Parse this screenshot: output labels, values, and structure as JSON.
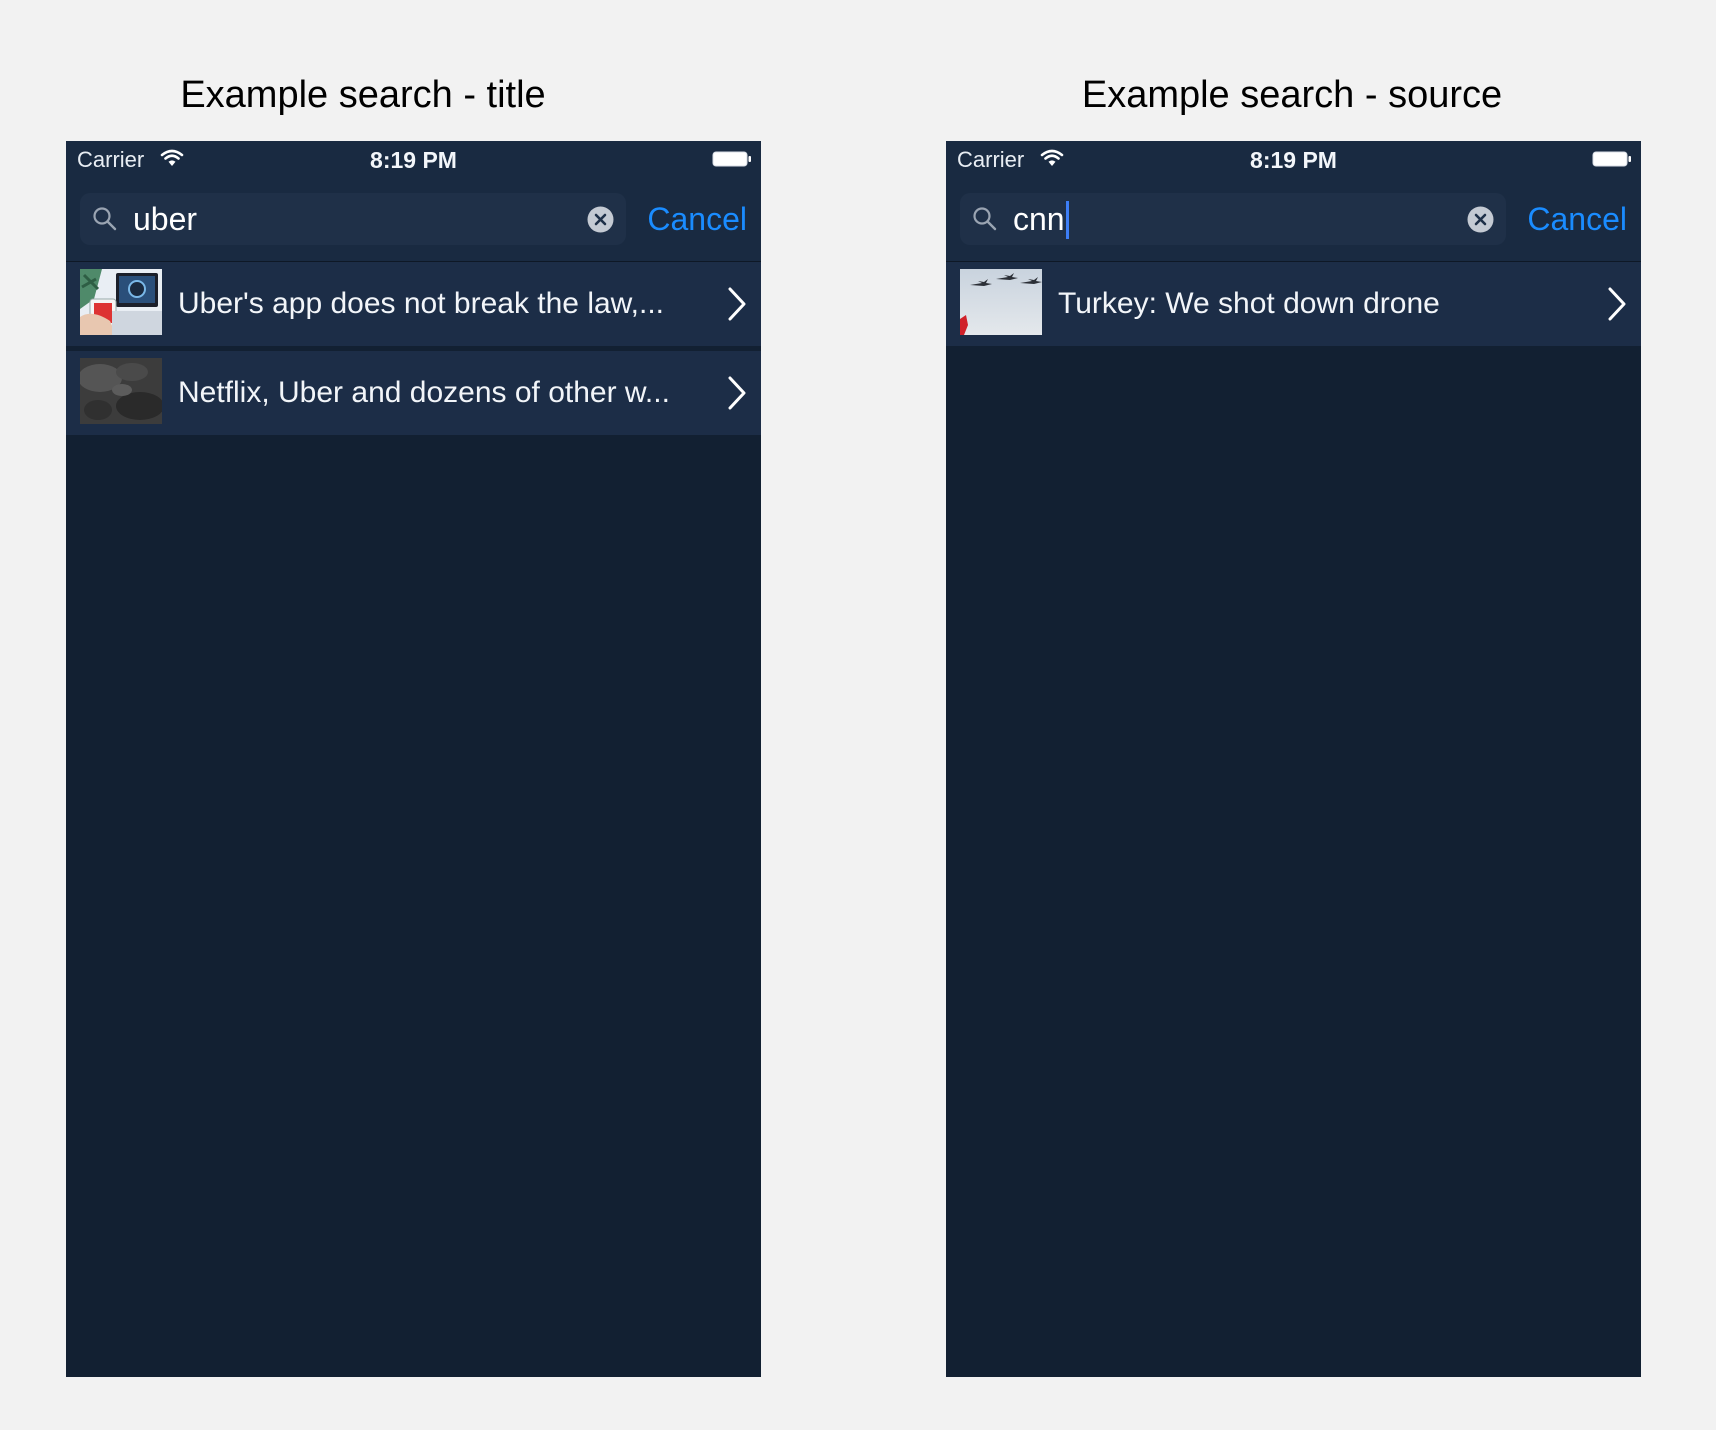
{
  "captions": {
    "left": "Example search - title",
    "right": "Example search - source"
  },
  "colors": {
    "page_background": "#f2f2f2",
    "app_background": "#122032",
    "bar_background": "#192a41",
    "row_background": "#1c2d47",
    "accent": "#1a8cff"
  },
  "phones": [
    {
      "status": {
        "carrier": "Carrier",
        "time": "8:19 PM"
      },
      "search": {
        "query": "uber",
        "cancel_label": "Cancel",
        "focused": false
      },
      "results": [
        {
          "title": "Uber's app does not break the law,...",
          "thumbnail": "laptop-phone-photo"
        },
        {
          "title": "Netflix, Uber and dozens of other w...",
          "thumbnail": "dark-texture-photo"
        }
      ]
    },
    {
      "status": {
        "carrier": "Carrier",
        "time": "8:19 PM"
      },
      "search": {
        "query": "cnn",
        "cancel_label": "Cancel",
        "focused": true
      },
      "results": [
        {
          "title": "Turkey: We shot down drone",
          "thumbnail": "jets-sky-photo"
        }
      ]
    }
  ]
}
